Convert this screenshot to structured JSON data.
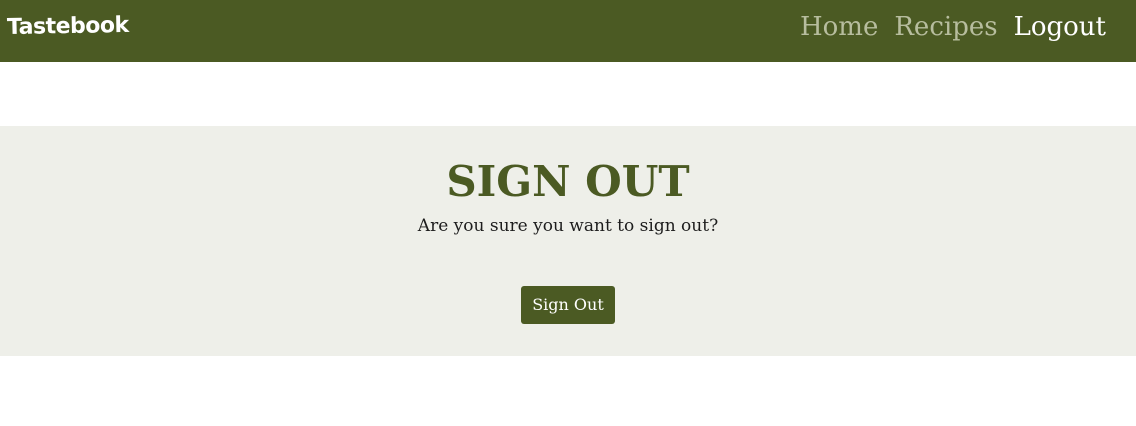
{
  "navbar": {
    "brand": "Tastebook",
    "links": [
      {
        "label": "Home",
        "active": false
      },
      {
        "label": "Recipes",
        "active": false
      },
      {
        "label": "Logout",
        "active": true
      }
    ]
  },
  "main": {
    "title": "SIGN OUT",
    "message": "Are you sure you want to sign out?",
    "button_label": "Sign Out"
  },
  "colors": {
    "brand": "#4b5a23",
    "panel_bg": "#eeefe9",
    "nav_link_inactive": "#b7bd9e",
    "nav_link_active": "#ffffff"
  }
}
